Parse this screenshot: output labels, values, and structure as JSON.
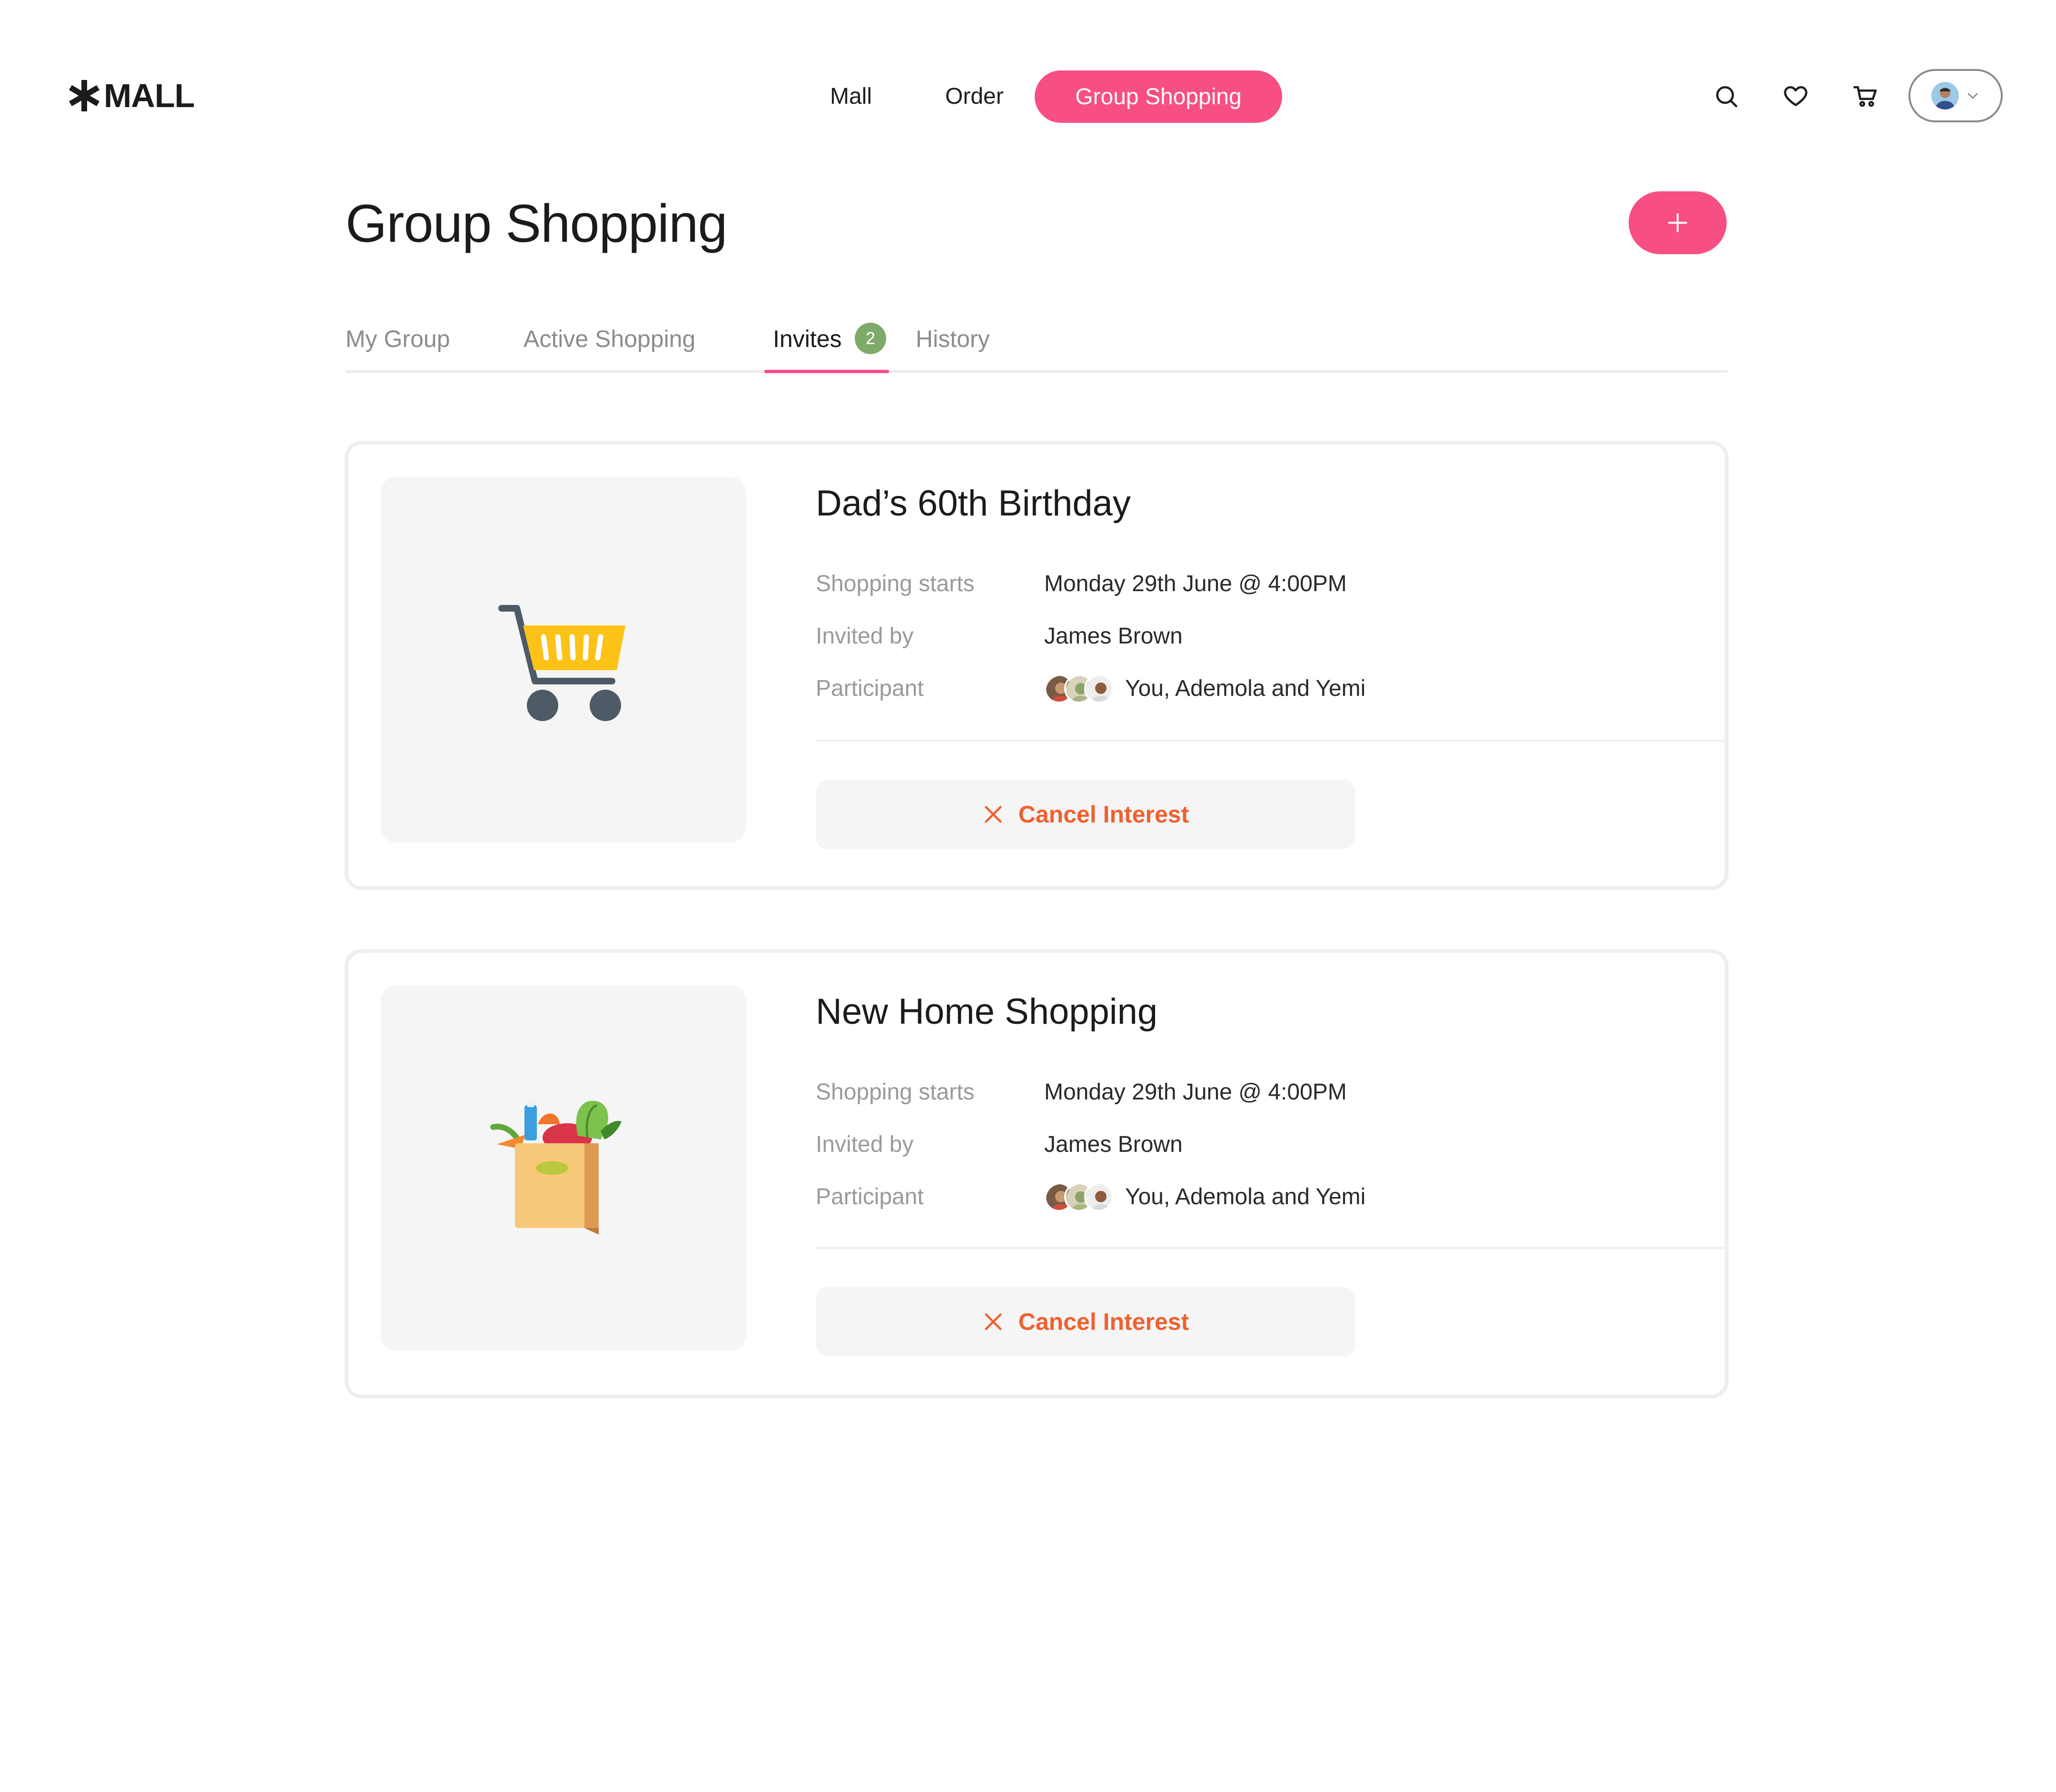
{
  "app": {
    "logo_text": "MALL"
  },
  "nav": {
    "links": [
      {
        "label": "Mall"
      },
      {
        "label": "Order"
      },
      {
        "label": "Group Shopping"
      }
    ],
    "icons": [
      "search-icon",
      "heart-icon",
      "cart-icon"
    ],
    "accent_color": "#f74f83"
  },
  "page": {
    "title": "Group Shopping",
    "add_label": "+"
  },
  "tabs": [
    {
      "label": "My Group"
    },
    {
      "label": "Active Shopping"
    },
    {
      "label": "Invites",
      "badge": "2",
      "active": true
    },
    {
      "label": "History"
    }
  ],
  "labels": {
    "shopping_starts": "Shopping starts",
    "invited_by": "Invited by",
    "participant": "Participant",
    "cancel": "Cancel Interest"
  },
  "cards": [
    {
      "title": "Dad’s 60th Birthday",
      "image_icon": "shopping-cart-illustration",
      "shopping_starts": "Monday 29th June @ 4:00PM",
      "invited_by": "James Brown",
      "participants": "You, Ademola and Yemi",
      "cancel_label": "Cancel Interest"
    },
    {
      "title": "New Home Shopping",
      "image_icon": "grocery-bag-illustration",
      "shopping_starts": "Monday 29th June @ 4:00PM",
      "invited_by": "James Brown",
      "participants": "You, Ademola and Yemi",
      "cancel_label": "Cancel Interest"
    }
  ]
}
